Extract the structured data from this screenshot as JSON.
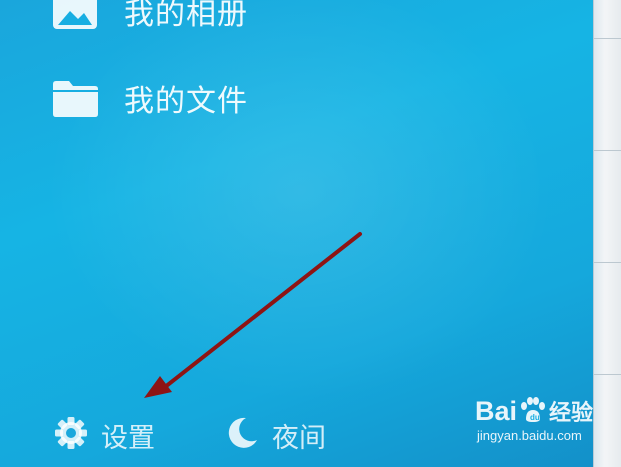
{
  "menu": {
    "items": [
      {
        "label": "我的相册",
        "icon": "image-icon"
      },
      {
        "label": "我的文件",
        "icon": "folder-icon"
      }
    ]
  },
  "bottom_bar": {
    "settings_label": "设置",
    "settings_icon": "gear-icon",
    "night_label": "夜间",
    "night_icon": "moon-icon"
  },
  "watermark": {
    "brand": "Bai",
    "brand_suffix": "经验",
    "url": "jingyan.baidu.com"
  },
  "colors": {
    "background": "#16b0e2",
    "arrow": "#8e1414",
    "text": "#ffffff"
  }
}
